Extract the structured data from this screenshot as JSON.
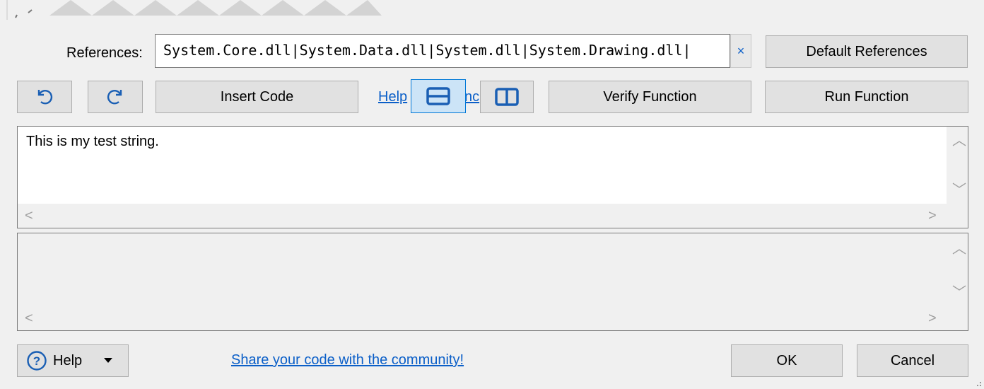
{
  "references": {
    "label": "References:",
    "value": "System.Core.dll|System.Data.dll|System.dll|System.Drawing.dll|",
    "clear_glyph": "×",
    "default_label": "Default References"
  },
  "toolbar": {
    "insert_code_label": "Insert Code",
    "help_link_left": "Help",
    "help_link_right": "nc",
    "verify_label": "Verify Function",
    "run_label": "Run Function"
  },
  "input_pane": {
    "text": "This is my test string."
  },
  "output_pane": {
    "text": ""
  },
  "footer": {
    "help_label": "Help",
    "share_link": "Share your code with the community!",
    "ok_label": "OK",
    "cancel_label": "Cancel"
  },
  "icons": [
    "undo-icon",
    "redo-icon",
    "horizontal-split-icon",
    "vertical-split-icon",
    "help-circle-icon",
    "dropdown-arrow-icon"
  ],
  "colors": {
    "accent_blue": "#0b5fc8",
    "selected_bg": "#cce4f7",
    "selected_border": "#0078d7"
  }
}
